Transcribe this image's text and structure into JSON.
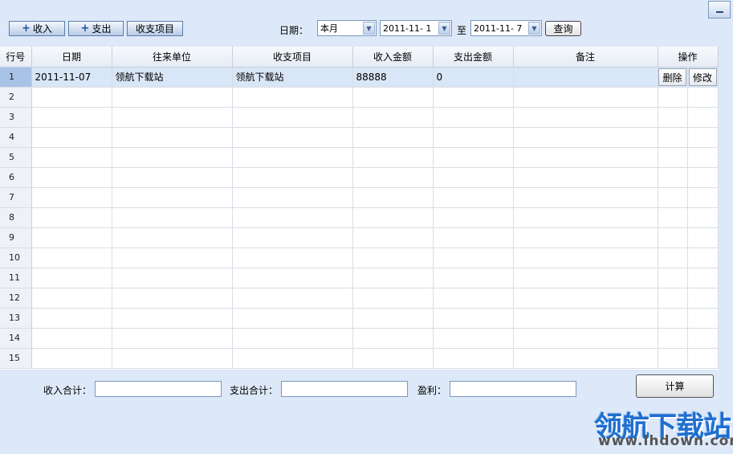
{
  "toolbar": {
    "income_button": "收入",
    "expense_button": "支出",
    "items_button": "收支项目",
    "date_label": "日期：",
    "period_value": "本月",
    "start_date": "2011-11- 1",
    "to_label": "至",
    "end_date": "2011-11- 7",
    "query_button": "查询"
  },
  "table": {
    "headers": [
      "行号",
      "日期",
      "往来单位",
      "收支项目",
      "收入金额",
      "支出金额",
      "备注",
      "操作"
    ],
    "row_numbers": [
      "1",
      "2",
      "3",
      "4",
      "5",
      "6",
      "7",
      "8",
      "9",
      "10",
      "11",
      "12",
      "13",
      "14",
      "15"
    ],
    "rows": [
      {
        "date": "2011-11-07",
        "partner": "领航下载站",
        "item": "领航下载站",
        "income": "88888",
        "expense": "0",
        "note": ""
      }
    ],
    "delete_label": "删除",
    "edit_label": "修改"
  },
  "footer": {
    "income_total_label": "收入合计：",
    "expense_total_label": "支出合计：",
    "profit_label": "盈利：",
    "calc_button": "计算"
  },
  "watermark": {
    "name": "领航下载站",
    "url": "www.lhdown.com"
  },
  "colors": {
    "background": "#dde8f8",
    "selected_row": "#d9e6f7",
    "accent": "#1f6fd0"
  }
}
